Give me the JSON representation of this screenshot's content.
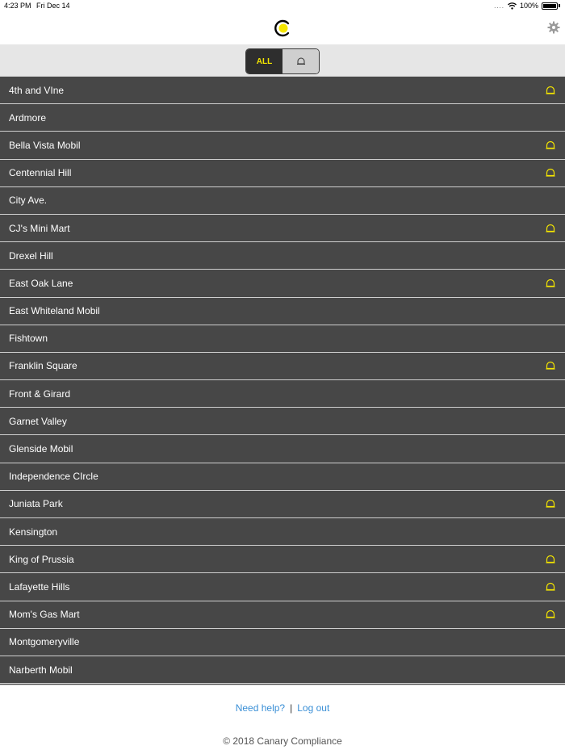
{
  "status": {
    "time": "4:23 PM",
    "date": "Fri Dec 14",
    "battery": "100%",
    "signal": "....",
    "wifi_icon": "wifi-icon"
  },
  "nav": {
    "logo_icon": "canary-logo-icon",
    "settings_icon": "gear-icon"
  },
  "filter": {
    "all_label": "ALL",
    "alert_icon": "bell-icon",
    "selected": "ALL"
  },
  "colors": {
    "accent": "#f5e600",
    "row_bg": "#474747",
    "link": "#3a8fd6"
  },
  "locations": [
    {
      "name": "4th and VIne",
      "alert": true
    },
    {
      "name": "Ardmore",
      "alert": false
    },
    {
      "name": "Bella Vista Mobil",
      "alert": true
    },
    {
      "name": "Centennial Hill",
      "alert": true
    },
    {
      "name": "City Ave.",
      "alert": false
    },
    {
      "name": "CJ's Mini Mart",
      "alert": true
    },
    {
      "name": "Drexel Hill",
      "alert": false
    },
    {
      "name": "East Oak Lane",
      "alert": true
    },
    {
      "name": "East Whiteland Mobil",
      "alert": false
    },
    {
      "name": "Fishtown",
      "alert": false
    },
    {
      "name": "Franklin Square",
      "alert": true
    },
    {
      "name": "Front & Girard",
      "alert": false
    },
    {
      "name": "Garnet Valley",
      "alert": false
    },
    {
      "name": "Glenside Mobil",
      "alert": false
    },
    {
      "name": "Independence CIrcle",
      "alert": false
    },
    {
      "name": "Juniata Park",
      "alert": true
    },
    {
      "name": "Kensington",
      "alert": false
    },
    {
      "name": "King of Prussia",
      "alert": true
    },
    {
      "name": "Lafayette Hills",
      "alert": true
    },
    {
      "name": "Mom's Gas Mart",
      "alert": true
    },
    {
      "name": "Montgomeryville",
      "alert": false
    },
    {
      "name": "Narberth Mobil",
      "alert": false
    }
  ],
  "footer": {
    "help_label": "Need help?",
    "separator": "|",
    "logout_label": "Log out",
    "copyright": "© 2018 Canary Compliance"
  }
}
